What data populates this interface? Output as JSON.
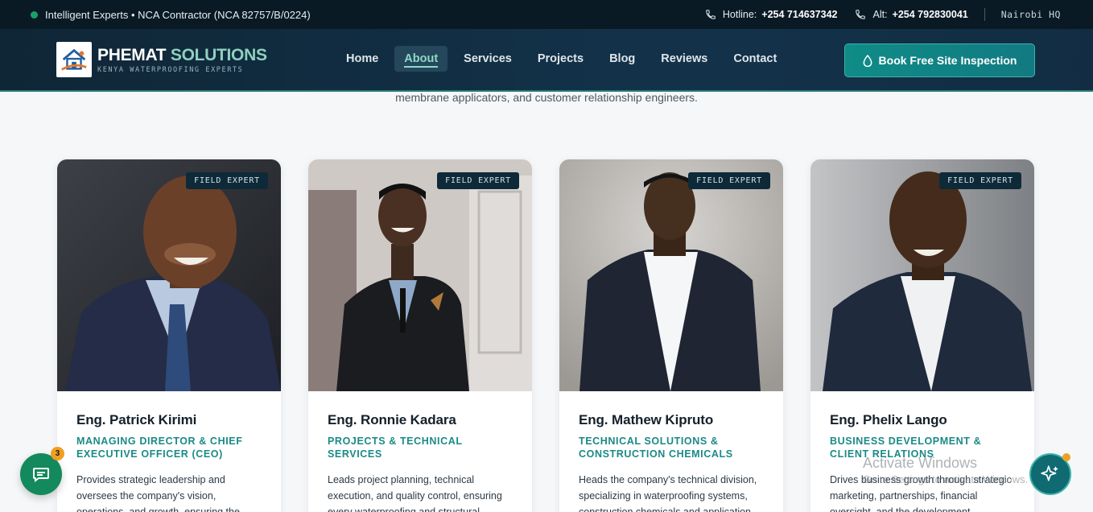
{
  "topbar": {
    "status": "Intelligent Experts • NCA Contractor (NCA 82757/B/0224)",
    "hotline_label": "Hotline:",
    "hotline_number": "+254 714637342",
    "alt_label": "Alt:",
    "alt_number": "+254 792830041",
    "location": "Nairobi HQ"
  },
  "brand": {
    "name_part1": "PHEMAT",
    "name_part2": "SOLUTIONS",
    "tagline": "KENYA WATERPROOFING EXPERTS"
  },
  "nav": {
    "items": [
      {
        "label": "Home"
      },
      {
        "label": "About"
      },
      {
        "label": "Services"
      },
      {
        "label": "Projects"
      },
      {
        "label": "Blog"
      },
      {
        "label": "Reviews"
      },
      {
        "label": "Contact"
      }
    ],
    "active": "About",
    "cta": "Book Free Site Inspection"
  },
  "intro": "membrane applicators, and customer relationship engineers.",
  "team": [
    {
      "badge": "FIELD EXPERT",
      "name": "Eng. Patrick Kirimi",
      "role": "MANAGING DIRECTOR & CHIEF EXECUTIVE OFFICER (CEO)",
      "desc": "Provides strategic leadership and oversees the company's vision, operations, and growth, ensuring the"
    },
    {
      "badge": "FIELD EXPERT",
      "name": "Eng. Ronnie Kadara",
      "role": "PROJECTS & TECHNICAL SERVICES",
      "desc": "Leads project planning, technical execution, and quality control, ensuring every waterproofing and structural protection project is completed to the"
    },
    {
      "badge": "FIELD EXPERT",
      "name": "Eng. Mathew Kipruto",
      "role": "TECHNICAL SOLUTIONS & CONSTRUCTION CHEMICALS",
      "desc": "Heads the company's technical division, specializing in waterproofing systems, construction chemicals and application"
    },
    {
      "badge": "FIELD EXPERT",
      "name": "Eng. Phelix Lango",
      "role": "BUSINESS DEVELOPMENT & CLIENT RELATIONS",
      "desc": "Drives business growth through strategic marketing, partnerships, financial oversight, and the development"
    }
  ],
  "chat": {
    "count": "3"
  },
  "watermark": {
    "line1": "Activate Windows",
    "line2": "Go to Settings to activate Windows."
  },
  "colors": {
    "accent": "#1a8a86",
    "topbar": "#0a1a25",
    "nav": "#13324a"
  }
}
